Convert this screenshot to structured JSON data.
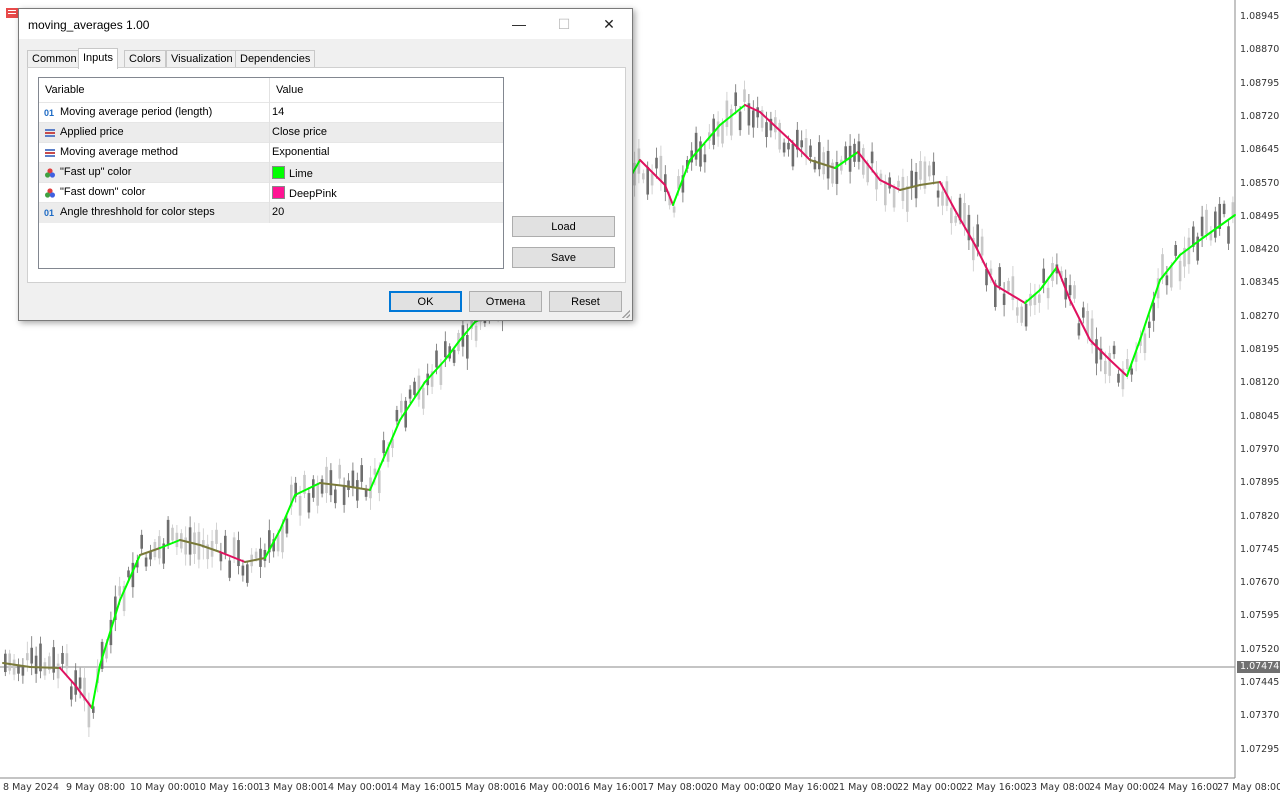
{
  "chart": {
    "price_axis": [
      "1.08945",
      "1.08870",
      "1.08795",
      "1.08720",
      "1.08645",
      "1.08570",
      "1.08495",
      "1.08420",
      "1.08345",
      "1.08270",
      "1.08195",
      "1.08120",
      "1.08045",
      "1.07970",
      "1.07895",
      "1.07820",
      "1.07745",
      "1.07670",
      "1.07595",
      "1.07520",
      "1.07445",
      "1.07370",
      "1.07295"
    ],
    "current_price": "1.07474",
    "time_axis": [
      "8 May 2024",
      "9 May 08:00",
      "10 May 00:00",
      "10 May 16:00",
      "13 May 08:00",
      "14 May 00:00",
      "14 May 16:00",
      "15 May 08:00",
      "16 May 00:00",
      "16 May 16:00",
      "17 May 08:00",
      "20 May 00:00",
      "20 May 16:00",
      "21 May 08:00",
      "22 May 00:00",
      "22 May 16:00",
      "23 May 08:00",
      "24 May 00:00",
      "24 May 16:00",
      "27 May 08:00"
    ],
    "colors": {
      "fast_up": "#00ff00",
      "fast_down": "#e0115f",
      "neutral": "#7a7a3a",
      "candle": "#6e6e6e",
      "candle_light": "#c8c8c8"
    }
  },
  "dialog": {
    "title": "moving_averages 1.00",
    "minimize_glyph": "—",
    "maximize_glyph": "☐",
    "close_glyph": "✕",
    "tabs": [
      "Common",
      "Inputs",
      "Colors",
      "Visualization",
      "Dependencies"
    ],
    "active_tab": "Inputs",
    "grid": {
      "headers": {
        "variable": "Variable",
        "value": "Value"
      },
      "rows": [
        {
          "icon": "int-icon",
          "icon_text": "01",
          "variable": "Moving average period (length)",
          "value": "14"
        },
        {
          "icon": "enum-icon",
          "icon_text": "",
          "variable": "Applied price",
          "value": "Close price"
        },
        {
          "icon": "enum-icon",
          "icon_text": "",
          "variable": "Moving average method",
          "value": "Exponential"
        },
        {
          "icon": "color-icon",
          "icon_text": "",
          "variable": "\"Fast up\" color",
          "value": "Lime",
          "swatch": "#00ff00"
        },
        {
          "icon": "color-icon",
          "icon_text": "",
          "variable": "\"Fast down\" color",
          "value": "DeepPink",
          "swatch": "#ff1493"
        },
        {
          "icon": "int-icon",
          "icon_text": "01",
          "variable": "Angle threshhold for color steps",
          "value": "20"
        }
      ]
    },
    "buttons": {
      "load": "Load",
      "save": "Save",
      "ok": "OK",
      "cancel": "Отмена",
      "reset": "Reset"
    }
  }
}
